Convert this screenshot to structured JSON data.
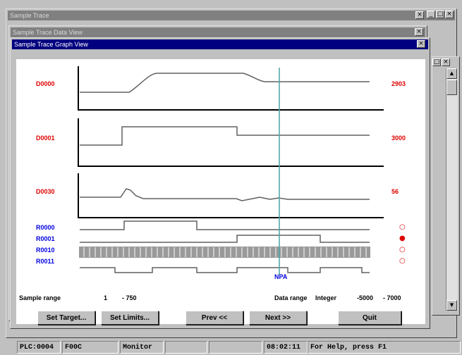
{
  "windows": {
    "outer_title": "Sample Trace",
    "data_view_title": "Sample Trace Data View",
    "graph_view_title": "Sample Trace Graph View"
  },
  "glyphs": {
    "close": "×",
    "minimize": "_",
    "maximize": "□",
    "scroll_up": "▲",
    "scroll_down": "▼"
  },
  "graph": {
    "channels": [
      {
        "name": "D0000",
        "value": "2903",
        "color": "#e00000"
      },
      {
        "name": "D0001",
        "value": "3000",
        "color": "#e00000"
      },
      {
        "name": "D0030",
        "value": "56",
        "color": "#e00000"
      }
    ],
    "bits": [
      {
        "name": "R0000",
        "state": "○",
        "color": "#0000e0"
      },
      {
        "name": "R0001",
        "state": "●",
        "color": "#0000e0"
      },
      {
        "name": "R0010",
        "state": "○",
        "color": "#0000e0"
      },
      {
        "name": "R0011",
        "state": "○",
        "color": "#0000e0"
      }
    ],
    "cursor_label": "NPA",
    "sample_range_label": "Sample range",
    "sample_from": "1",
    "sample_to": "- 750",
    "data_range_label": "Data range",
    "data_type": "Integer",
    "data_min": "-5000",
    "data_max": "- 7000"
  },
  "buttons": {
    "set_target": "Set Target...",
    "set_limits": "Set Limits...",
    "prev": "Prev <<",
    "next": "Next >>",
    "quit": "Quit"
  },
  "statusbar": {
    "plc": "PLC:0004",
    "port": "F00C",
    "mode": "Monitor",
    "time": "08:02:11",
    "help": "For Help, press F1"
  }
}
